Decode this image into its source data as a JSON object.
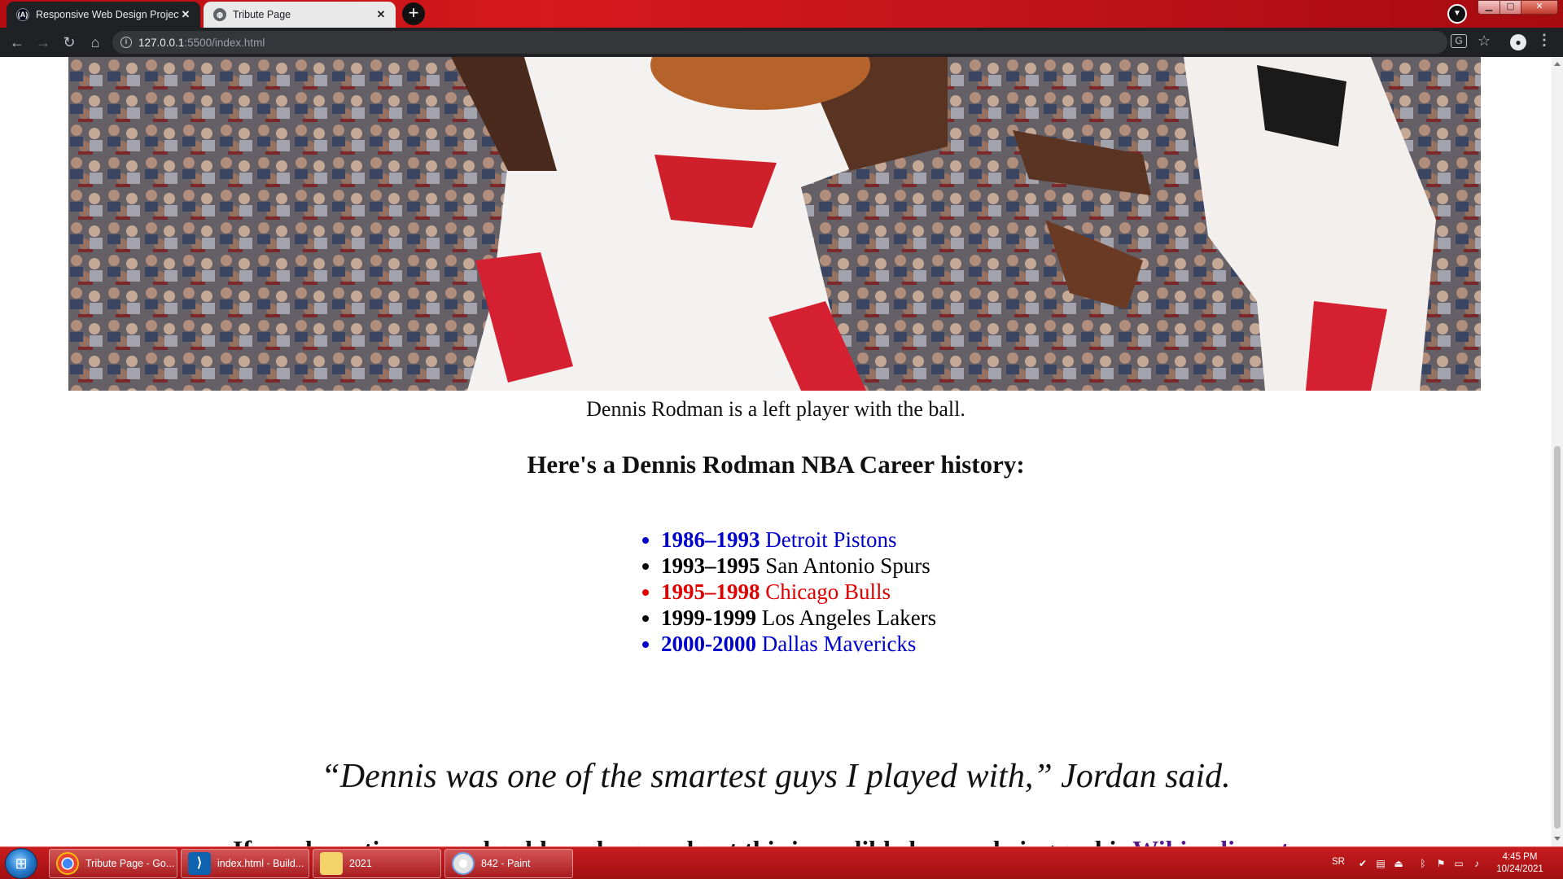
{
  "browser": {
    "tabs": [
      {
        "title": "Responsive Web Design Projects",
        "favicon": "(A)"
      },
      {
        "title": "Tribute Page",
        "favicon": "globe"
      }
    ],
    "new_tab_label": "+",
    "url_host": "127.0.0.1",
    "url_path": ":5500/index.html"
  },
  "page": {
    "image_caption": "Dennis Rodman is a left player with the ball.",
    "history_heading": "Here's a Dennis Rodman NBA Career history:",
    "career": [
      {
        "years": "1986–1993",
        "team": "Detroit Pistons",
        "color": "#0000cc"
      },
      {
        "years": "1993–1995",
        "team": "San Antonio Spurs",
        "color": "#000000"
      },
      {
        "years": "1995–1998",
        "team": "Chicago Bulls",
        "color": "#e00000"
      },
      {
        "years": "1999-1999",
        "team": "Los Angeles Lakers",
        "color": "#000000"
      },
      {
        "years": "2000-2000",
        "team": "Dallas Mavericks",
        "color": "#0000cc"
      }
    ],
    "quote": "“Dennis was one of the smartest guys I played with,” Jordan said.",
    "footer_prefix": "If you have time, you should read more about this incredible human being on his ",
    "footer_link": "Wikipedia entry",
    "footer_suffix": "."
  },
  "taskbar": {
    "items": [
      {
        "label": "Tribute Page - Go...",
        "icon": "chrome-icon"
      },
      {
        "label": "index.html - Build...",
        "icon": "vscode-icon"
      },
      {
        "label": "2021",
        "icon": "folder-icon"
      },
      {
        "label": "842 - Paint",
        "icon": "paint-icon"
      }
    ],
    "language": "SR",
    "time": "4:45 PM",
    "date": "10/24/2021"
  }
}
